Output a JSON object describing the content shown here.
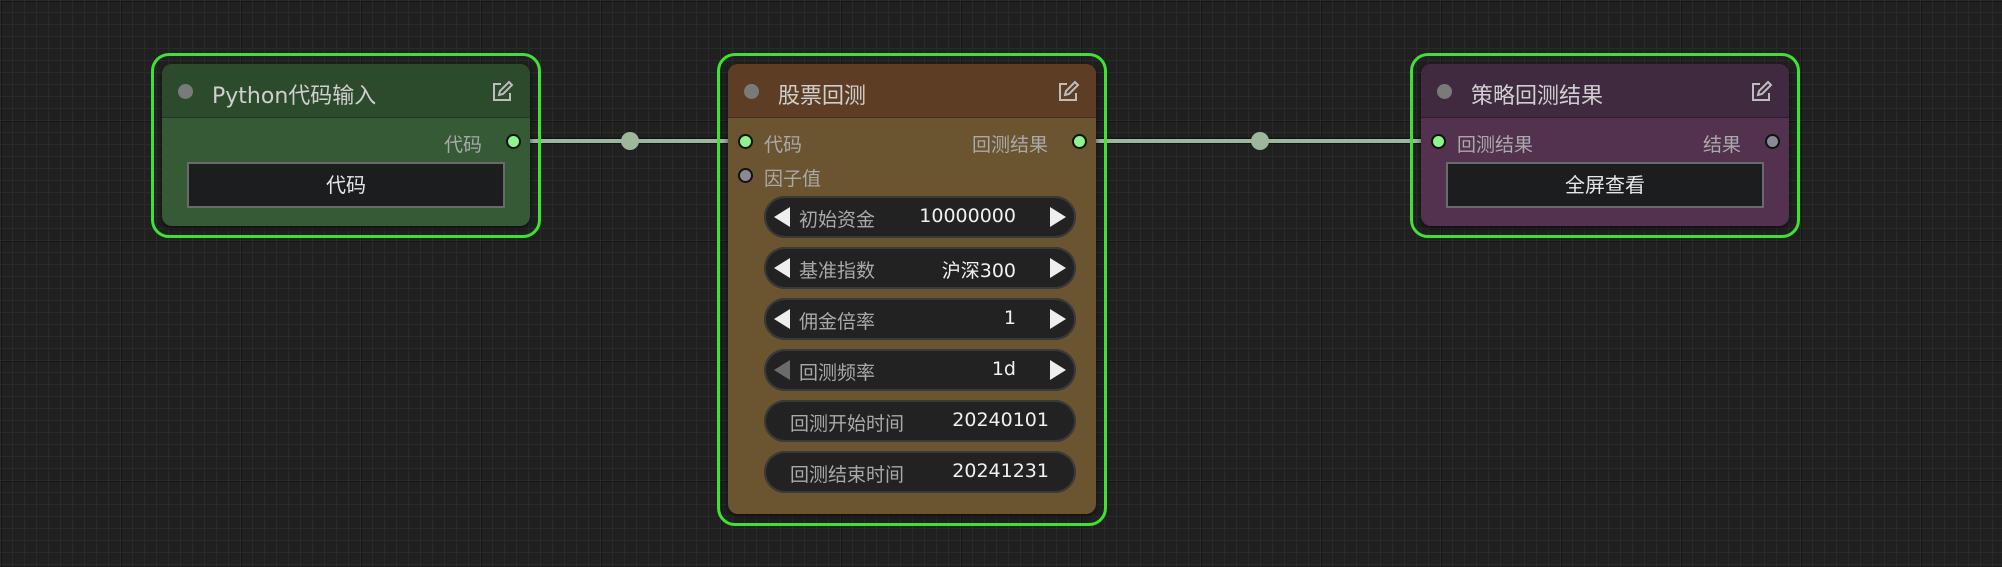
{
  "theme": {
    "canvas_bg": "#202020",
    "selection_outline": "#3fe133",
    "link_color": "#9db79d",
    "slot_connected": "#8cf58c",
    "slot_empty": "#8a8a96"
  },
  "nodes": {
    "python_input": {
      "title": "Python代码输入",
      "header_color": "#2c4a2c",
      "body_color": "#355a35",
      "outputs": [
        {
          "label": "代码",
          "connected": true
        }
      ],
      "button_label": "代码",
      "icons": {
        "status": "circle-dot-icon",
        "edit": "edit-icon"
      }
    },
    "stock_backtest": {
      "title": "股票回测",
      "header_color": "#5d3e24",
      "body_color": "#6b5430",
      "inputs": [
        {
          "label": "代码",
          "connected": true
        },
        {
          "label": "因子值",
          "connected": false
        }
      ],
      "outputs": [
        {
          "label": "回测结果",
          "connected": true
        }
      ],
      "widgets": [
        {
          "label": "初始资金",
          "value": "10000000",
          "type": "stepper",
          "left_enabled": true
        },
        {
          "label": "基准指数",
          "value": "沪深300",
          "type": "combo",
          "left_enabled": true
        },
        {
          "label": "佣金倍率",
          "value": "1",
          "type": "stepper",
          "left_enabled": true
        },
        {
          "label": "回测频率",
          "value": "1d",
          "type": "combo",
          "left_enabled": false
        },
        {
          "label": "回测开始时间",
          "value": "20240101",
          "type": "text"
        },
        {
          "label": "回测结束时间",
          "value": "20241231",
          "type": "text"
        }
      ],
      "icons": {
        "status": "circle-dot-icon",
        "edit": "edit-icon"
      }
    },
    "strategy_result": {
      "title": "策略回测结果",
      "header_color": "#3f2a40",
      "body_color": "#53324f",
      "inputs": [
        {
          "label": "回测结果",
          "connected": true
        }
      ],
      "outputs": [
        {
          "label": "结果",
          "connected": false
        }
      ],
      "button_label": "全屏查看",
      "icons": {
        "status": "circle-dot-icon",
        "edit": "edit-icon"
      }
    }
  }
}
